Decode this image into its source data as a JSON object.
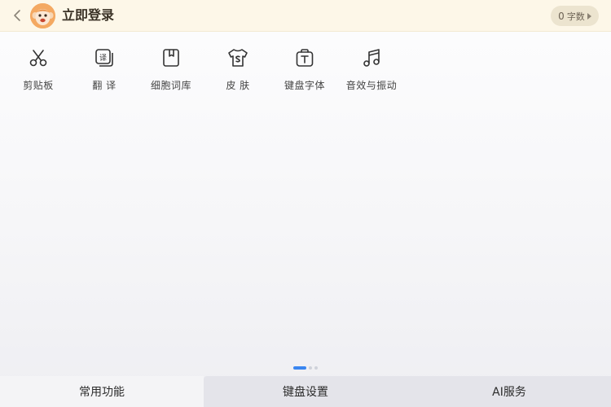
{
  "header": {
    "title": "立即登录",
    "word_count": {
      "number": "0",
      "unit": "字数"
    },
    "back_icon": "chevron-left-icon",
    "avatar_icon": "monkey-avatar"
  },
  "tools": [
    {
      "label": "剪贴板",
      "icon": "scissors-icon"
    },
    {
      "label": "翻 译",
      "icon": "translate-icon"
    },
    {
      "label": "细胞词库",
      "icon": "book-icon"
    },
    {
      "label": "皮 肤",
      "icon": "tshirt-icon"
    },
    {
      "label": "键盘字体",
      "icon": "font-icon"
    },
    {
      "label": "音效与振动",
      "icon": "music-note-icon"
    }
  ],
  "pager": {
    "pages": 3,
    "active": 0
  },
  "tabs": [
    {
      "label": "常用功能",
      "active": true
    },
    {
      "label": "键盘设置",
      "active": false
    },
    {
      "label": "AI服务",
      "active": false
    }
  ],
  "colors": {
    "header_bg": "#fdf7e8",
    "accent": "#3a86f0",
    "tab_active_bg": "#f4f4f6",
    "tab_inactive_bg": "#e4e4ea",
    "icon_stroke": "#333333"
  }
}
